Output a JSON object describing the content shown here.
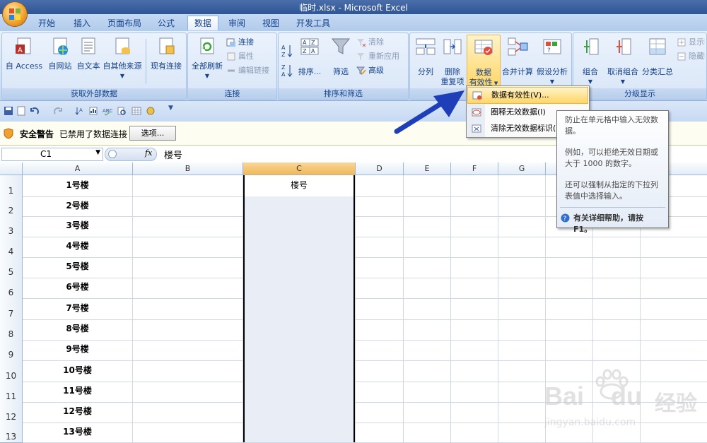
{
  "window": {
    "title": "临时.xlsx - Microsoft Excel"
  },
  "tabs": [
    {
      "label": "开始"
    },
    {
      "label": "插入"
    },
    {
      "label": "页面布局"
    },
    {
      "label": "公式"
    },
    {
      "label": "数据",
      "active": true
    },
    {
      "label": "审阅"
    },
    {
      "label": "视图"
    },
    {
      "label": "开发工具"
    }
  ],
  "ribbon": {
    "groups": {
      "external": {
        "label": "获取外部数据",
        "buttons": [
          {
            "label": "自 Access",
            "icon": "access-db-icon"
          },
          {
            "label": "自网站",
            "icon": "web-globe-icon"
          },
          {
            "label": "自文本",
            "icon": "text-file-icon"
          },
          {
            "label": "自其他来源",
            "icon": "other-sources-icon",
            "dropdown": true
          },
          {
            "label": "现有连接",
            "icon": "existing-connections-icon"
          }
        ]
      },
      "connections": {
        "label": "连接",
        "refresh": {
          "label": "全部刷新",
          "icon": "refresh-all-icon",
          "dropdown": true
        },
        "small": [
          {
            "label": "连接",
            "icon": "connections-icon",
            "enabled": true
          },
          {
            "label": "属性",
            "icon": "properties-icon",
            "enabled": false
          },
          {
            "label": "编辑链接",
            "icon": "edit-links-icon",
            "enabled": false
          }
        ]
      },
      "sort": {
        "label": "排序和筛选",
        "az": "A→Z",
        "za": "Z→A",
        "sort": {
          "label": "排序...",
          "icon": "sort-dialog-icon"
        },
        "filter": {
          "label": "筛选",
          "icon": "filter-funnel-icon"
        },
        "small": [
          {
            "label": "清除",
            "icon": "clear-filter-icon",
            "enabled": false
          },
          {
            "label": "重新应用",
            "icon": "reapply-icon",
            "enabled": false
          },
          {
            "label": "高级",
            "icon": "advanced-filter-icon",
            "enabled": true
          }
        ]
      },
      "tools": {
        "label": "",
        "buttons": [
          {
            "label": "分列",
            "icon": "text-to-columns-icon"
          },
          {
            "label": "删除\n重复项",
            "line1": "删除",
            "line2": "重复项",
            "icon": "remove-duplicates-icon"
          },
          {
            "label": "数据\n有效性",
            "line1": "数据",
            "line2": "有效性",
            "icon": "data-validation-icon",
            "dropdown": true
          },
          {
            "label": "合并计算",
            "icon": "consolidate-icon"
          },
          {
            "label": "假设分析",
            "icon": "what-if-icon",
            "dropdown": true
          }
        ]
      },
      "outline": {
        "label": "分级显示",
        "buttons": [
          {
            "label": "组合",
            "icon": "group-icon",
            "dropdown": true
          },
          {
            "label": "取消组合",
            "icon": "ungroup-icon",
            "dropdown": true
          },
          {
            "label": "分类汇总",
            "icon": "subtotal-icon"
          }
        ],
        "small": [
          {
            "label": "显示明",
            "icon": "show-detail-icon"
          },
          {
            "label": "隐藏明",
            "icon": "hide-detail-icon"
          }
        ]
      }
    }
  },
  "dropdown": {
    "items": [
      {
        "label": "数据有效性(V)...",
        "icon": "data-validation-icon",
        "highlighted": true
      },
      {
        "label": "圈释无效数据(I)",
        "icon": "circle-invalid-icon"
      },
      {
        "label": "清除无效数据标识(R)",
        "icon": "clear-circles-icon"
      }
    ]
  },
  "tooltip": {
    "line1": "防止在单元格中输入无效数",
    "line2": "据。",
    "line3": "例如，可以拒绝无效日期或",
    "line4": "大于 1000 的数字。",
    "line5": "还可以强制从指定的下拉列",
    "line6": "表值中选择输入。",
    "help": "有关详细帮助，请按 F1。"
  },
  "security": {
    "title": "安全警告",
    "message": "已禁用了数据连接",
    "options_button": "选项..."
  },
  "formula": {
    "name_box": "C1",
    "fx": "fx",
    "content": "楼号"
  },
  "sheet": {
    "columns": [
      "A",
      "B",
      "C",
      "D",
      "E",
      "F",
      "G"
    ],
    "selected_column": "C",
    "rows": [
      {
        "n": "1",
        "a": "1号楼",
        "c": "楼号"
      },
      {
        "n": "2",
        "a": "2号楼",
        "c": ""
      },
      {
        "n": "3",
        "a": "3号楼",
        "c": ""
      },
      {
        "n": "4",
        "a": "4号楼",
        "c": ""
      },
      {
        "n": "5",
        "a": "5号楼",
        "c": ""
      },
      {
        "n": "6",
        "a": "6号楼",
        "c": ""
      },
      {
        "n": "7",
        "a": "7号楼",
        "c": ""
      },
      {
        "n": "8",
        "a": "8号楼",
        "c": ""
      },
      {
        "n": "9",
        "a": "9号楼",
        "c": ""
      },
      {
        "n": "10",
        "a": "10号楼",
        "c": ""
      },
      {
        "n": "11",
        "a": "11号楼",
        "c": ""
      },
      {
        "n": "12",
        "a": "12号楼",
        "c": ""
      },
      {
        "n": "13",
        "a": "13号楼",
        "c": ""
      }
    ]
  },
  "watermark": {
    "brand": "Bai",
    "brand2": "du",
    "cn": "经验",
    "url": "jingyan.baidu.com"
  },
  "colors": {
    "ribbon_text": "#15428b",
    "selection_header": "#f1b856",
    "arrow": "#1f3fb8"
  }
}
